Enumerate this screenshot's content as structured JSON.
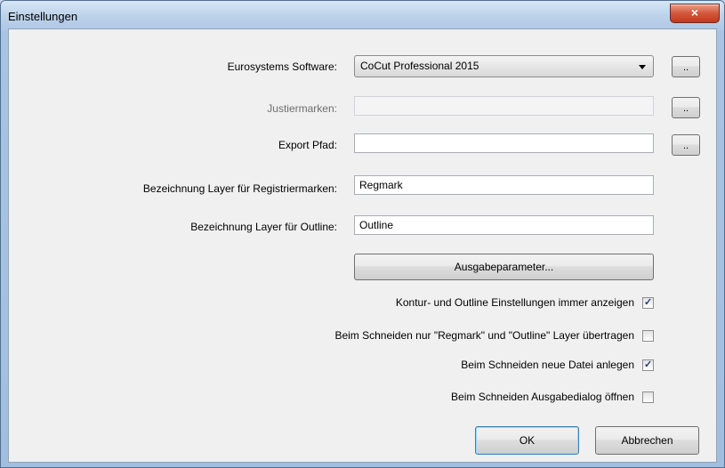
{
  "window": {
    "title": "Einstellungen",
    "close_glyph": "×"
  },
  "form": {
    "software": {
      "label": "Eurosystems Software:",
      "value": "CoCut Professional 2015",
      "browse_label": ".."
    },
    "marks": {
      "label": "Justiermarken:",
      "value": "",
      "browse_label": ".."
    },
    "export": {
      "label": "Export Pfad:",
      "value": "",
      "browse_label": ".."
    },
    "regmark_layer": {
      "label": "Bezeichnung Layer für Registriermarken:",
      "value": "Regmark"
    },
    "outline_layer": {
      "label": "Bezeichnung Layer für Outline:",
      "value": "Outline"
    },
    "output_params_label": "Ausgabeparameter..."
  },
  "checkboxes": [
    {
      "label": "Kontur- und Outline Einstellungen immer anzeigen",
      "checked": true
    },
    {
      "label": "Beim Schneiden nur \"Regmark\" und \"Outline\" Layer übertragen",
      "checked": false
    },
    {
      "label": "Beim Schneiden neue Datei anlegen",
      "checked": true
    },
    {
      "label": "Beim Schneiden Ausgabedialog öffnen",
      "checked": false
    }
  ],
  "check_glyph": "✓",
  "buttons": {
    "ok_label": "OK",
    "cancel_label": "Abbrechen"
  }
}
